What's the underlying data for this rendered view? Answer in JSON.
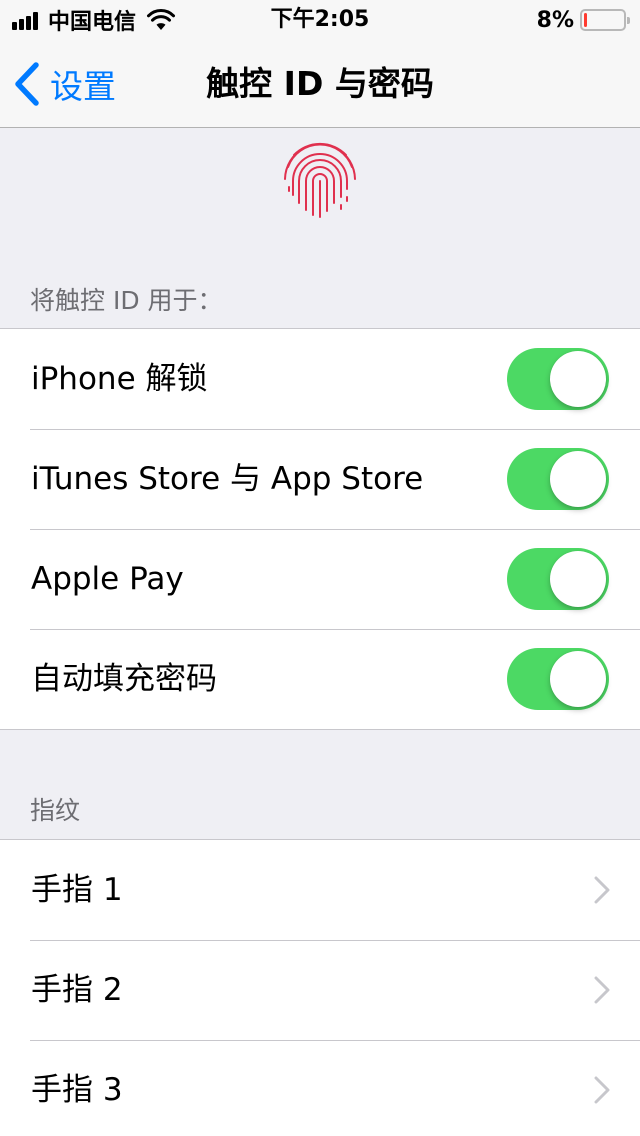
{
  "status_bar": {
    "carrier": "中国电信",
    "time": "下午2:05",
    "battery_percent": "8%",
    "battery_level": 0.08,
    "signal_icon": "signal-bars-icon",
    "wifi_icon": "wifi-icon",
    "battery_icon": "battery-icon"
  },
  "nav": {
    "back_label": "设置",
    "back_icon": "chevron-left-icon",
    "title": "触控 ID 与密码"
  },
  "fingerprint_icon": "fingerprint-icon",
  "touch_id_section": {
    "header": "将触控 ID 用于：",
    "items": [
      {
        "label": "iPhone 解锁",
        "on": true
      },
      {
        "label": "iTunes Store 与 App Store",
        "on": true
      },
      {
        "label": "Apple Pay",
        "on": true
      },
      {
        "label": "自动填充密码",
        "on": true
      }
    ]
  },
  "fingerprints_section": {
    "header": "指纹",
    "items": [
      {
        "label": "手指 1"
      },
      {
        "label": "手指 2"
      },
      {
        "label": "手指 3"
      }
    ]
  },
  "colors": {
    "accent": "#007aff",
    "toggle_on": "#4cd964",
    "fingerprint": "#e0304e",
    "battery_low": "#ff3b30",
    "background": "#efeff4"
  }
}
